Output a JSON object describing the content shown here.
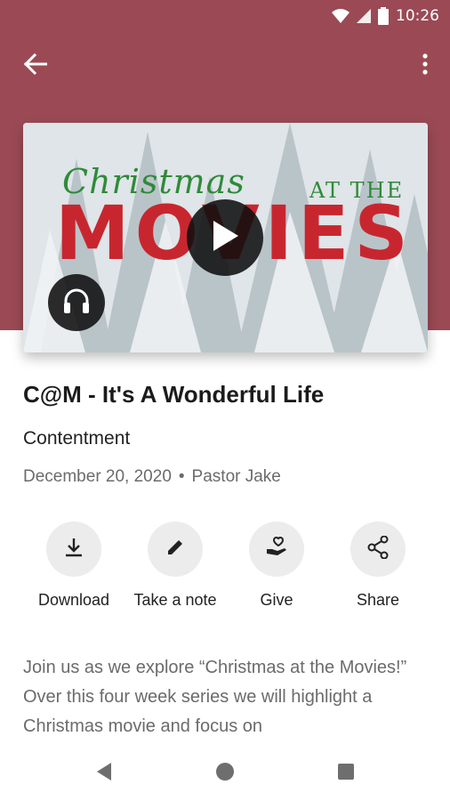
{
  "status_bar": {
    "time": "10:26",
    "icons": [
      "wifi-icon",
      "cellular-signal-icon",
      "battery-icon"
    ]
  },
  "app_bar": {
    "back_icon": "arrow-back-icon",
    "more_icon": "more-vertical-icon"
  },
  "artwork": {
    "script_text": "Christmas",
    "title_text": "MOVIES",
    "at_text": "AT THE",
    "play_icon": "play-icon",
    "audio_icon": "headphones-icon"
  },
  "episode": {
    "title": "C@M - It's A Wonderful Life",
    "subtitle": "Contentment",
    "date": "December 20, 2020",
    "separator": "•",
    "speaker": "Pastor Jake"
  },
  "actions": [
    {
      "label": "Download",
      "icon": "download-icon"
    },
    {
      "label": "Take a note",
      "icon": "pencil-icon"
    },
    {
      "label": "Give",
      "icon": "give-hand-heart-icon"
    },
    {
      "label": "Share",
      "icon": "share-icon"
    }
  ],
  "description": "Join us as we explore “Christmas at the Movies!” Over this four week series we will highlight a Christmas movie and focus on",
  "nav_bar": {
    "icons": [
      "nav-back-icon",
      "nav-home-icon",
      "nav-recents-icon"
    ]
  },
  "colors": {
    "header": "#9b4a55",
    "action_circle": "#ececec",
    "muted_text": "#6b6b6b"
  }
}
